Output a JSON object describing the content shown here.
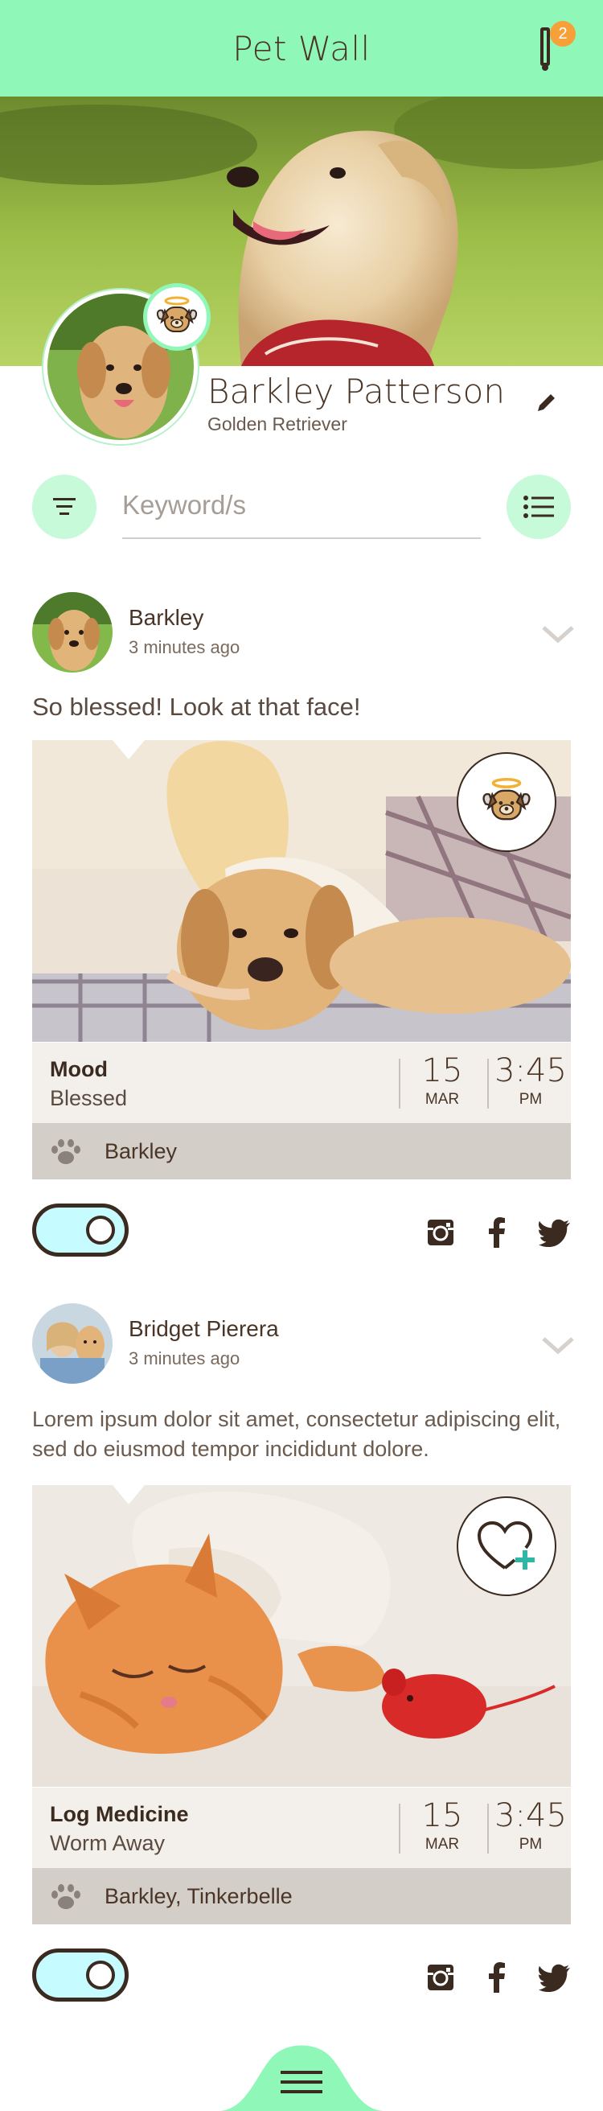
{
  "app": {
    "title": "Pet Wall",
    "notification_count": "2"
  },
  "profile": {
    "name": "Barkley Patterson",
    "breed": "Golden Retriever"
  },
  "search": {
    "placeholder": "Keyword/s"
  },
  "posts": [
    {
      "author": "Barkley",
      "time": "3 minutes ago",
      "text": "So blessed! Look at that face!",
      "meta_title": "Mood",
      "meta_value": "Blessed",
      "day": "15",
      "month": "MAR",
      "clock": "3:45",
      "ampm": "PM",
      "tags": "Barkley",
      "badge_icon": "angel-dog-icon"
    },
    {
      "author": "Bridget Pierera",
      "time": "3 minutes ago",
      "text": "Lorem ipsum dolor sit amet, consectetur adipiscing elit, sed do eiusmod tempor incididunt dolore.",
      "meta_title": "Log Medicine",
      "meta_value": "Worm Away",
      "day": "15",
      "month": "MAR",
      "clock": "3:45",
      "ampm": "PM",
      "tags": "Barkley, Tinkerbelle",
      "badge_icon": "heart-plus-icon"
    }
  ],
  "colors": {
    "accent": "#8ff7b8",
    "accent_light": "#c6fad9",
    "text": "#4a3527",
    "badge": "#f6a03a",
    "toggle": "#c6fbff"
  }
}
